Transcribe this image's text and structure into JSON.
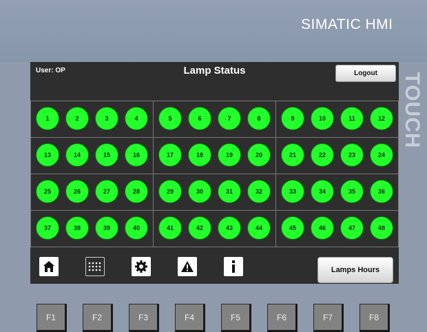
{
  "brand": "SIMATIC HMI",
  "side_label": "TOUCH",
  "screen": {
    "user": "User: OP",
    "title": "Lamp Status",
    "logout_label": "Logout",
    "lamps_hours_label": "Lamps Hours"
  },
  "lamps": [
    "1",
    "2",
    "3",
    "4",
    "5",
    "6",
    "7",
    "8",
    "9",
    "10",
    "11",
    "12",
    "13",
    "14",
    "15",
    "16",
    "17",
    "18",
    "19",
    "20",
    "21",
    "22",
    "23",
    "24",
    "25",
    "26",
    "27",
    "28",
    "29",
    "30",
    "31",
    "32",
    "33",
    "34",
    "35",
    "36",
    "37",
    "38",
    "39",
    "40",
    "41",
    "42",
    "43",
    "44",
    "45",
    "46",
    "47",
    "48"
  ],
  "lamp_state": "on",
  "nav_icons": [
    "home-icon",
    "grid-icon",
    "gear-icon",
    "warning-icon",
    "info-icon"
  ],
  "nav_active": "grid-icon",
  "function_keys": [
    "F1",
    "F2",
    "F3",
    "F4",
    "F5",
    "F6",
    "F7",
    "F8"
  ],
  "colors": {
    "lamp_on": "#22ff2a",
    "screen_bg": "#2e2e2e",
    "bezel": "#8f9aac"
  }
}
